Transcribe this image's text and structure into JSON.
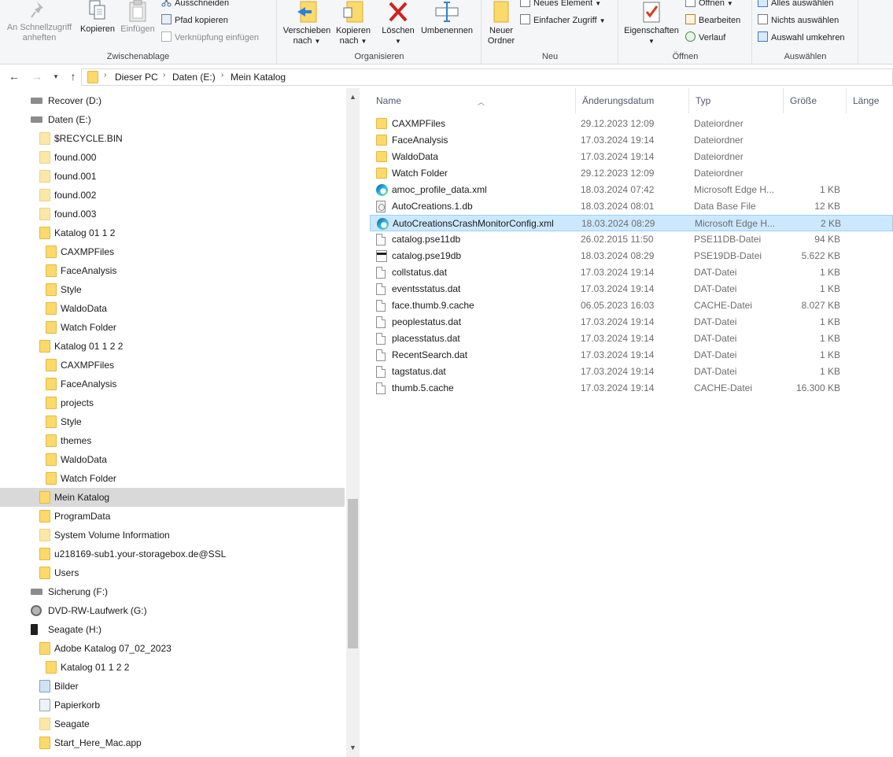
{
  "ribbon": {
    "clipboard": {
      "label": "Zwischenablage",
      "pin": "An Schnellzugriff anheften",
      "copy": "Kopieren",
      "paste": "Einfügen",
      "cut": "Ausschneiden",
      "copy_path": "Pfad kopieren",
      "paste_shortcut": "Verknüpfung einfügen"
    },
    "organize": {
      "label": "Organisieren",
      "move_to_1": "Verschieben",
      "move_to_2": "nach",
      "copy_to_1": "Kopieren",
      "copy_to_2": "nach",
      "delete": "Löschen",
      "rename": "Umbenennen"
    },
    "new": {
      "label": "Neu",
      "new_folder_1": "Neuer",
      "new_folder_2": "Ordner",
      "new_item": "Neues Element",
      "easy_access": "Einfacher Zugriff"
    },
    "open": {
      "label": "Öffnen",
      "properties": "Eigenschaften",
      "open": "Öffnen",
      "edit": "Bearbeiten",
      "history": "Verlauf"
    },
    "select": {
      "label": "Auswählen",
      "select_all": "Alles auswählen",
      "select_none": "Nichts auswählen",
      "invert": "Auswahl umkehren"
    }
  },
  "address": {
    "crumbs": [
      "Dieser PC",
      "Daten (E:)",
      "Mein Katalog"
    ]
  },
  "tree": [
    {
      "label": "Recover (D:)",
      "icon": "drive-icon",
      "level": 1
    },
    {
      "label": "Daten (E:)",
      "icon": "drive-icon",
      "level": 1
    },
    {
      "label": "$RECYCLE.BIN",
      "icon": "folder-light-icon",
      "level": 2
    },
    {
      "label": "found.000",
      "icon": "folder-light-icon",
      "level": 2
    },
    {
      "label": "found.001",
      "icon": "folder-light-icon",
      "level": 2
    },
    {
      "label": "found.002",
      "icon": "folder-light-icon",
      "level": 2
    },
    {
      "label": "found.003",
      "icon": "folder-light-icon",
      "level": 2
    },
    {
      "label": "Katalog 01 1 2",
      "icon": "folder-icon",
      "level": 2
    },
    {
      "label": "CAXMPFiles",
      "icon": "folder-icon",
      "level": 3
    },
    {
      "label": "FaceAnalysis",
      "icon": "folder-icon",
      "level": 3
    },
    {
      "label": "Style",
      "icon": "folder-icon",
      "level": 3
    },
    {
      "label": "WaldoData",
      "icon": "folder-icon",
      "level": 3
    },
    {
      "label": "Watch Folder",
      "icon": "folder-icon",
      "level": 3
    },
    {
      "label": "Katalog 01 1 2 2",
      "icon": "folder-icon",
      "level": 2
    },
    {
      "label": "CAXMPFiles",
      "icon": "folder-icon",
      "level": 3
    },
    {
      "label": "FaceAnalysis",
      "icon": "folder-icon",
      "level": 3
    },
    {
      "label": "projects",
      "icon": "folder-icon",
      "level": 3
    },
    {
      "label": "Style",
      "icon": "folder-icon",
      "level": 3
    },
    {
      "label": "themes",
      "icon": "folder-icon",
      "level": 3
    },
    {
      "label": "WaldoData",
      "icon": "folder-icon",
      "level": 3
    },
    {
      "label": "Watch Folder",
      "icon": "folder-icon",
      "level": 3
    },
    {
      "label": "Mein Katalog",
      "icon": "folder-icon",
      "level": 2,
      "selected": true
    },
    {
      "label": "ProgramData",
      "icon": "folder-icon",
      "level": 2
    },
    {
      "label": "System Volume Information",
      "icon": "folder-light-icon",
      "level": 2
    },
    {
      "label": "u218169-sub1.your-storagebox.de@SSL",
      "icon": "folder-icon",
      "level": 2
    },
    {
      "label": "Users",
      "icon": "folder-icon",
      "level": 2
    },
    {
      "label": "Sicherung (F:)",
      "icon": "drive-icon",
      "level": 1
    },
    {
      "label": "DVD-RW-Laufwerk (G:)",
      "icon": "dvd-icon",
      "level": 1
    },
    {
      "label": "Seagate (H:)",
      "icon": "external-drive-icon",
      "level": 1
    },
    {
      "label": "Adobe Katalog 07_02_2023",
      "icon": "folder-icon",
      "level": 2
    },
    {
      "label": "Katalog 01 1 2 2",
      "icon": "folder-icon",
      "level": 3
    },
    {
      "label": "Bilder",
      "icon": "pictures-icon",
      "level": 2
    },
    {
      "label": "Papierkorb",
      "icon": "recycle-bin-icon",
      "level": 2
    },
    {
      "label": "Seagate",
      "icon": "folder-light-icon",
      "level": 2
    },
    {
      "label": "Start_Here_Mac.app",
      "icon": "folder-icon",
      "level": 2
    }
  ],
  "columns": {
    "name": "Name",
    "date": "Änderungsdatum",
    "type": "Typ",
    "size": "Größe",
    "length": "Länge"
  },
  "files": [
    {
      "name": "CAXMPFiles",
      "date": "29.12.2023 12:09",
      "type": "Dateiordner",
      "size": "",
      "icon": "folder-icon"
    },
    {
      "name": "FaceAnalysis",
      "date": "17.03.2024 19:14",
      "type": "Dateiordner",
      "size": "",
      "icon": "folder-icon"
    },
    {
      "name": "WaldoData",
      "date": "17.03.2024 19:14",
      "type": "Dateiordner",
      "size": "",
      "icon": "folder-icon"
    },
    {
      "name": "Watch Folder",
      "date": "29.12.2023 12:09",
      "type": "Dateiordner",
      "size": "",
      "icon": "folder-icon"
    },
    {
      "name": "amoc_profile_data.xml",
      "date": "18.03.2024 07:42",
      "type": "Microsoft Edge H...",
      "size": "1 KB",
      "icon": "edge-icon"
    },
    {
      "name": "AutoCreations.1.db",
      "date": "18.03.2024 08:01",
      "type": "Data Base File",
      "size": "12 KB",
      "icon": "database-file-icon"
    },
    {
      "name": "AutoCreationsCrashMonitorConfig.xml",
      "date": "18.03.2024 08:29",
      "type": "Microsoft Edge H...",
      "size": "2 KB",
      "icon": "edge-icon",
      "selected": true
    },
    {
      "name": "catalog.pse11db",
      "date": "26.02.2015 11:50",
      "type": "PSE11DB-Datei",
      "size": "94 KB",
      "icon": "file-icon"
    },
    {
      "name": "catalog.pse19db",
      "date": "18.03.2024 08:29",
      "type": "PSE19DB-Datei",
      "size": "5.622 KB",
      "icon": "pse-file-icon"
    },
    {
      "name": "collstatus.dat",
      "date": "17.03.2024 19:14",
      "type": "DAT-Datei",
      "size": "1 KB",
      "icon": "file-icon"
    },
    {
      "name": "eventsstatus.dat",
      "date": "17.03.2024 19:14",
      "type": "DAT-Datei",
      "size": "1 KB",
      "icon": "file-icon"
    },
    {
      "name": "face.thumb.9.cache",
      "date": "06.05.2023 16:03",
      "type": "CACHE-Datei",
      "size": "8.027 KB",
      "icon": "file-icon"
    },
    {
      "name": "peoplestatus.dat",
      "date": "17.03.2024 19:14",
      "type": "DAT-Datei",
      "size": "1 KB",
      "icon": "file-icon"
    },
    {
      "name": "placesstatus.dat",
      "date": "17.03.2024 19:14",
      "type": "DAT-Datei",
      "size": "1 KB",
      "icon": "file-icon"
    },
    {
      "name": "RecentSearch.dat",
      "date": "17.03.2024 19:14",
      "type": "DAT-Datei",
      "size": "1 KB",
      "icon": "file-icon"
    },
    {
      "name": "tagstatus.dat",
      "date": "17.03.2024 19:14",
      "type": "DAT-Datei",
      "size": "1 KB",
      "icon": "file-icon"
    },
    {
      "name": "thumb.5.cache",
      "date": "17.03.2024 19:14",
      "type": "CACHE-Datei",
      "size": "16.300 KB",
      "icon": "file-icon"
    }
  ],
  "colors": {
    "selection": "#cce8ff",
    "selection_border": "#99d1ff",
    "tree_selection": "#d9d9d9",
    "folder": "#fbd96b"
  }
}
